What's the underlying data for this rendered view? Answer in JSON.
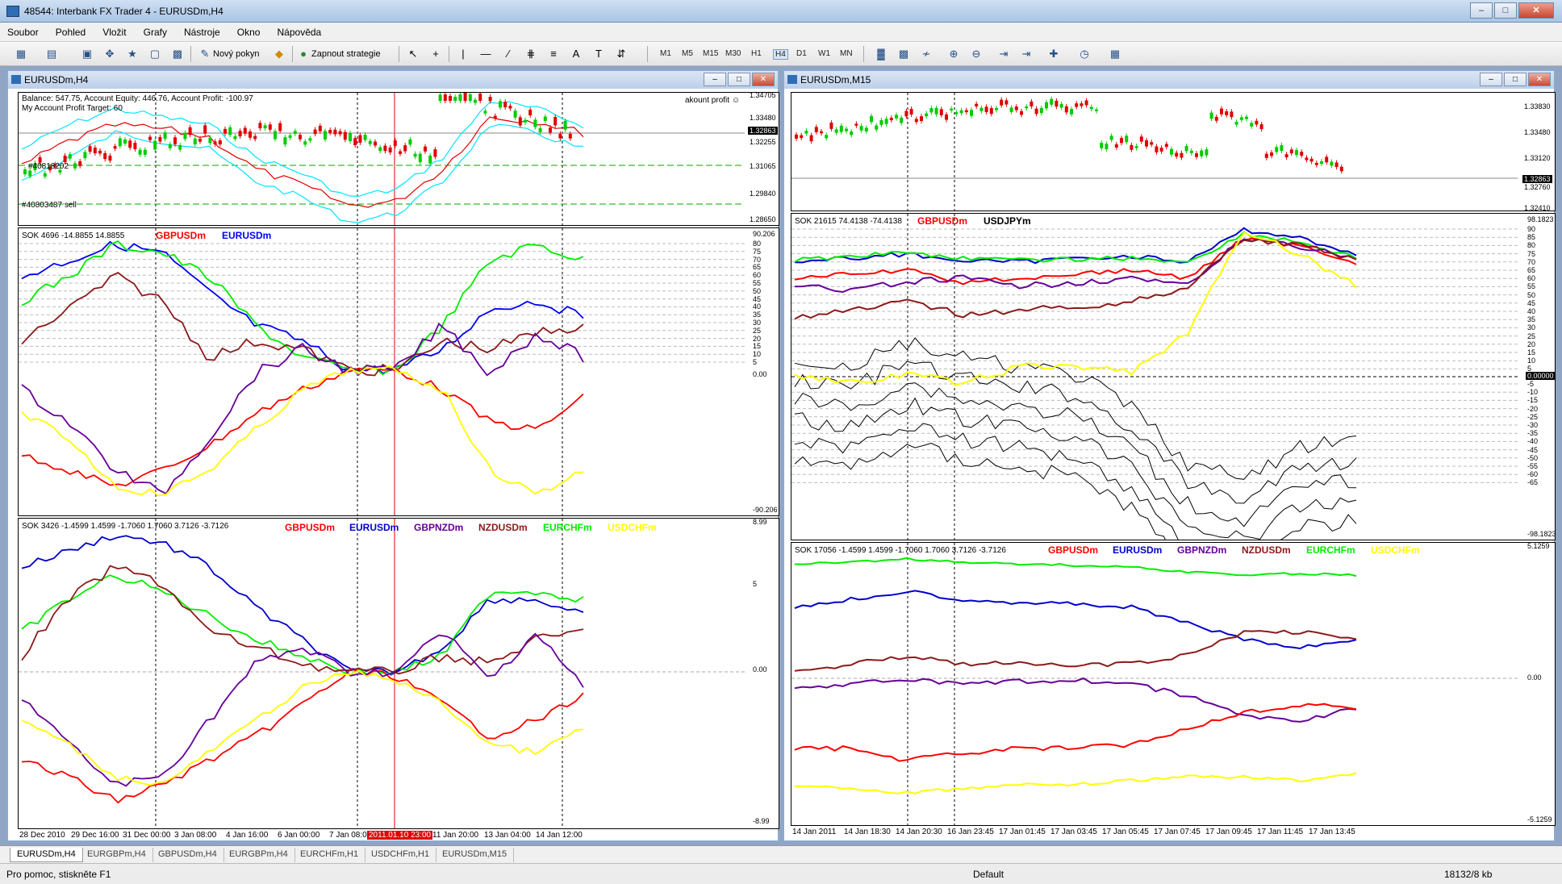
{
  "window": {
    "title": "48544: Interbank FX Trader 4 - EURUSDm,H4",
    "min_label": "–",
    "max_label": "□",
    "close_label": "✕"
  },
  "menu": [
    "Soubor",
    "Pohled",
    "Vložit",
    "Grafy",
    "Nástroje",
    "Okno",
    "Nápověda"
  ],
  "toolbar": {
    "new_order": "Nový pokyn",
    "strategy": "Zapnout strategie",
    "timeframes": [
      "M1",
      "M5",
      "M15",
      "M30",
      "H1",
      "H4",
      "D1",
      "W1",
      "MN"
    ]
  },
  "left_chart": {
    "title": "EURUSDm,H4",
    "price_info": {
      "line1": "Balance: 547.75, Account Equity: 446.76, Account Profit: -100.97",
      "line2": "My Account Profit Target: 60",
      "order1": "#40818202",
      "order2": "#40803487 sell",
      "akount": "akount profit ☺"
    },
    "price_axis": [
      "1.34705",
      "1.33480",
      "1.32863",
      "1.32255",
      "1.31065",
      "1.29840",
      "1.28650"
    ],
    "ind1": {
      "header": "SOK 4696 -14.8855 14.8855",
      "legend": [
        {
          "name": "GBPUSDm",
          "color": "#ff0000"
        },
        {
          "name": "EURUSDm",
          "color": "#0000ff"
        }
      ],
      "axis": [
        "90.206",
        "80",
        "75",
        "70",
        "65",
        "60",
        "55",
        "50",
        "45",
        "40",
        "35",
        "30",
        "25",
        "20",
        "15",
        "10",
        "5",
        "0.00",
        "-90.206"
      ]
    },
    "ind2": {
      "header": "SOK 3426 -1.4599 1.4599 -1.7060 1.7060 3.7126 -3.7126",
      "legend": [
        {
          "name": "GBPUSDm",
          "color": "#ff0000"
        },
        {
          "name": "EURUSDm",
          "color": "#0000cc"
        },
        {
          "name": "GBPNZDm",
          "color": "#660099"
        },
        {
          "name": "NZDUSDm",
          "color": "#8b1a1a"
        },
        {
          "name": "EURCHFm",
          "color": "#00ee00"
        },
        {
          "name": "USDCHFm",
          "color": "#ffff00"
        }
      ],
      "axis": [
        "8.99",
        "5",
        "0.00",
        "-8.99"
      ]
    },
    "dates": [
      "28 Dec 2010",
      "29 Dec 16:00",
      "31 Dec 00:00",
      "3 Jan 08:00",
      "4 Jan 16:00",
      "6 Jan 00:00",
      "7 Jan 08:00",
      "11 Jan 20:00",
      "13 Jan 04:00",
      "14 Jan 12:00"
    ],
    "date_marker": "2011.01.10 23:00"
  },
  "right_chart": {
    "title": "EURUSDm,M15",
    "price_axis": [
      "1.33830",
      "1.33480",
      "1.33120",
      "1.32863",
      "1.32760",
      "1.32410"
    ],
    "ind1": {
      "header": "SOK 21615 74.4138 -74.4138",
      "legend": [
        {
          "name": "GBPUSDm",
          "color": "#ff0000"
        },
        {
          "name": "USDJPYm",
          "color": "#000000"
        }
      ],
      "axis": [
        "98.1823",
        "90",
        "85",
        "80",
        "75",
        "70",
        "65",
        "60",
        "55",
        "50",
        "45",
        "40",
        "35",
        "30",
        "25",
        "20",
        "15",
        "10",
        "5",
        "0.00000",
        "-5",
        "-10",
        "-15",
        "-20",
        "-25",
        "-30",
        "-35",
        "-40",
        "-45",
        "-50",
        "-55",
        "-60",
        "-65",
        "-98.1823"
      ]
    },
    "ind2": {
      "header": "SOK 17056 -1.4599 1.4599 -1.7060 1.7060 3.7126 -3.7126",
      "legend": [
        {
          "name": "GBPUSDm",
          "color": "#ff0000"
        },
        {
          "name": "EURUSDm",
          "color": "#0000cc"
        },
        {
          "name": "GBPNZDm",
          "color": "#660099"
        },
        {
          "name": "NZDUSDm",
          "color": "#8b1a1a"
        },
        {
          "name": "EURCHFm",
          "color": "#00ee00"
        },
        {
          "name": "USDCHFm",
          "color": "#ffff00"
        }
      ],
      "axis": [
        "5.1259",
        "0.00",
        "-5.1259"
      ]
    },
    "dates": [
      "14 Jan 2011",
      "14 Jan 18:30",
      "14 Jan 20:30",
      "16 Jan 23:45",
      "17 Jan 01:45",
      "17 Jan 03:45",
      "17 Jan 05:45",
      "17 Jan 07:45",
      "17 Jan 09:45",
      "17 Jan 11:45",
      "17 Jan 13:45"
    ]
  },
  "tabs": [
    "EURUSDm,H4",
    "EURGBPm,H4",
    "GBPUSDm,H4",
    "EURGBPm,H4",
    "EURCHFm,H1",
    "USDCHFm,H1",
    "EURUSDm,M15"
  ],
  "status": {
    "help": "Pro pomoc, stiskněte F1",
    "profile": "Default",
    "traffic": "18132/8 kb"
  }
}
